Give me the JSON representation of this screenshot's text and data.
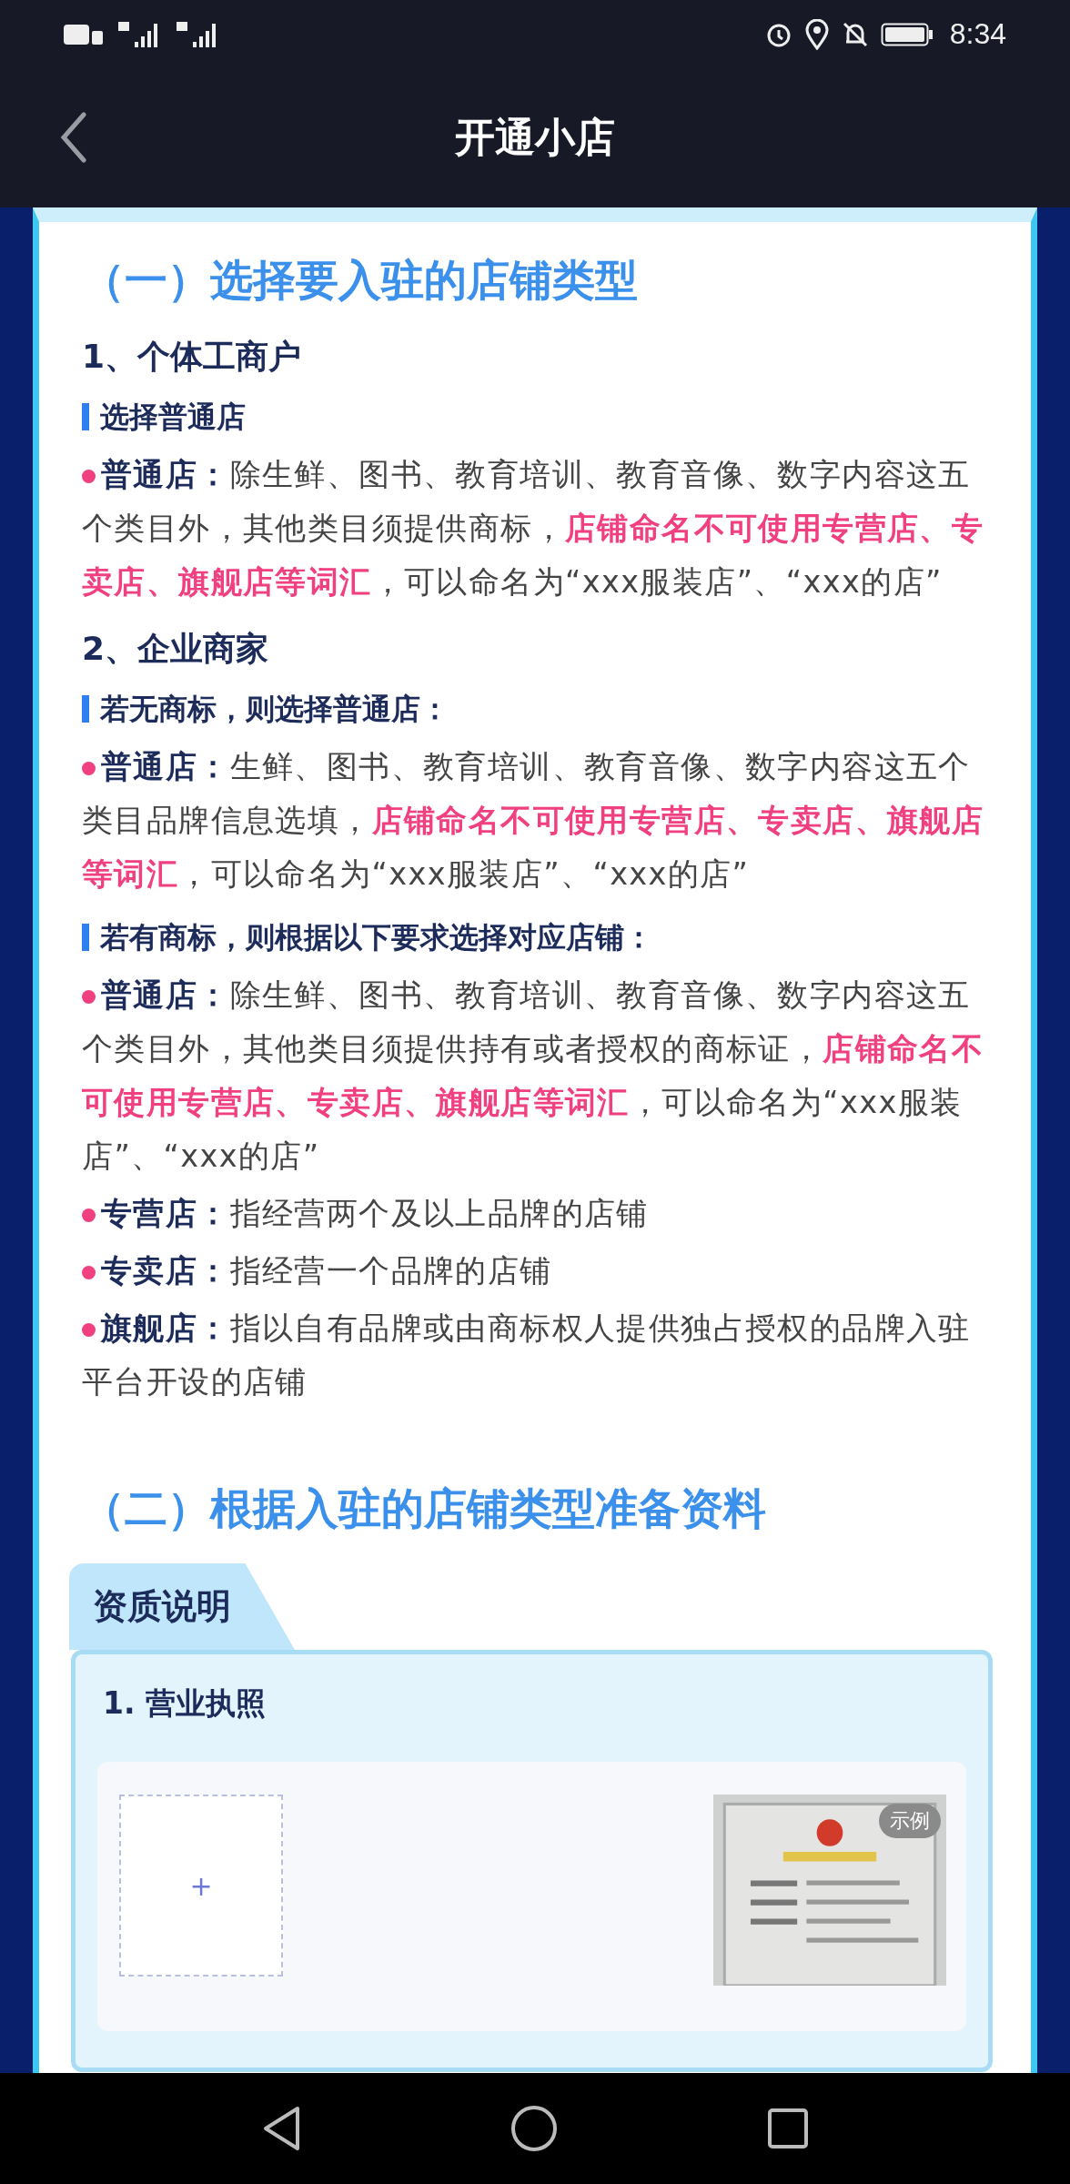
{
  "status_bar": {
    "time": "8:34"
  },
  "header": {
    "title": "开通小店"
  },
  "sections": [
    {
      "heading": "（一）选择要入驻的店铺类型",
      "groups": [
        {
          "title": "1、个体工商户",
          "blocks": [
            {
              "kind": "subheading",
              "text": "选择普通店"
            },
            {
              "kind": "bullet",
              "label": "普通店：",
              "text": "除生鲜、图书、教育培训、教育音像、数字内容这五个类目外，其他类目须提供商标，**店铺命名不可使用专营店、专卖店、旗舰店等词汇**，可以命名为“xxx服装店”、“xxx的店”"
            }
          ]
        },
        {
          "title": "2、企业商家",
          "blocks": [
            {
              "kind": "subheading",
              "text": "若无商标，则选择普通店："
            },
            {
              "kind": "bullet",
              "label": "普通店：",
              "text": "生鲜、图书、教育培训、教育音像、数字内容这五个类目品牌信息选填，**店铺命名不可使用专营店、专卖店、旗舰店等词汇**，可以命名为“xxx服装店”、“xxx的店”"
            },
            {
              "kind": "subheading",
              "text": "若有商标，则根据以下要求选择对应店铺："
            },
            {
              "kind": "bullet",
              "label": "普通店：",
              "text": "除生鲜、图书、教育培训、教育音像、数字内容这五个类目外，其他类目须提供持有或者授权的商标证，**店铺命名不可使用专营店、专卖店、旗舰店等词汇**，可以命名为“xxx服装店”、“xxx的店”"
            },
            {
              "kind": "bullet",
              "label": "专营店：",
              "text": "指经营两个及以上品牌的店铺"
            },
            {
              "kind": "bullet",
              "label": "专卖店：",
              "text": "指经营一个品牌的店铺"
            },
            {
              "kind": "bullet",
              "label": "旗舰店：",
              "text": "指以自有品牌或由商标权人提供独占授权的品牌入驻平台开设的店铺"
            }
          ]
        }
      ]
    },
    {
      "heading": "（二）根据入驻的店铺类型准备资料",
      "qualification": {
        "tab": "资质说明",
        "items": [
          {
            "title": "1. 营业执照",
            "upload": "+",
            "sample": {
              "kind": "picture",
              "badge": "示例"
            }
          }
        ]
      }
    }
  ]
}
